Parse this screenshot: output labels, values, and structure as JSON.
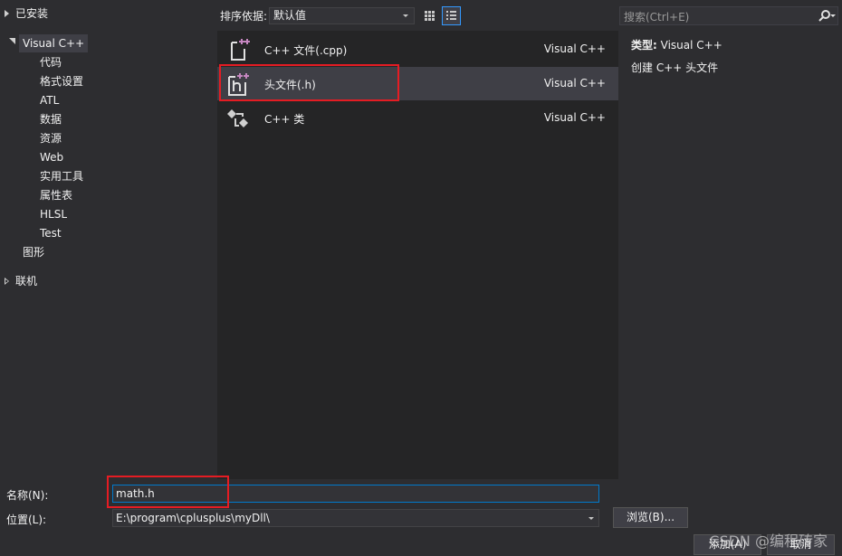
{
  "left_tree": {
    "installed_label": "已安装",
    "visual_cpp_label": "Visual C++",
    "children": [
      "代码",
      "格式设置",
      "ATL",
      "数据",
      "资源",
      "Web",
      "实用工具",
      "属性表",
      "HLSL",
      "Test"
    ],
    "graphics_label": "图形",
    "online_label": "联机"
  },
  "toolbar": {
    "sort_label": "排序依据:",
    "sort_value": "默认值"
  },
  "templates": [
    {
      "name": "C++ 文件(.cpp)",
      "language": "Visual C++",
      "icon": "cpp-file-icon"
    },
    {
      "name": "头文件(.h)",
      "language": "Visual C++",
      "icon": "header-file-icon"
    },
    {
      "name": "C++ 类",
      "language": "Visual C++",
      "icon": "cpp-class-icon"
    }
  ],
  "search": {
    "placeholder": "搜索(Ctrl+E)"
  },
  "details": {
    "type_label": "类型:",
    "type_value": "Visual C++",
    "description": "创建 C++ 头文件"
  },
  "form": {
    "name_label": "名称(N):",
    "name_value": "math.h",
    "location_label": "位置(L):",
    "location_value": "E:\\program\\cplusplus\\myDll\\",
    "browse_label": "浏览(B)...",
    "add_label": "添加(A)",
    "cancel_label": "取消"
  },
  "watermark": "CSDN @编程砖家",
  "colors": {
    "background": "#2d2d30",
    "list_background": "#252526",
    "selection": "#3f3f46",
    "accent": "#007acc",
    "highlight_box": "#e51c23",
    "icon_plus": "#c586c0"
  }
}
